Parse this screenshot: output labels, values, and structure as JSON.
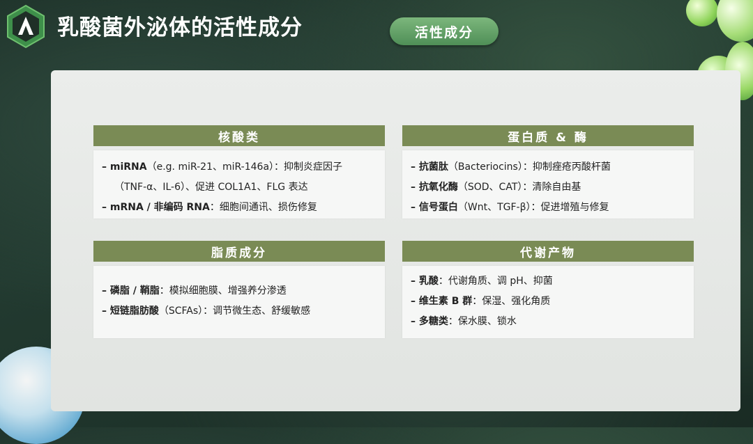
{
  "header": {
    "title": "乳酸菌外泌体的活性成分",
    "tag": "活性成分"
  },
  "cards": [
    {
      "heading": "核酸类",
      "items": [
        {
          "bold": "–  miRNA",
          "text": "（e.g. miR-21、miR-146a）：抑制炎症因子"
        },
        {
          "bold": "",
          "text": "（TNF-α、IL-6）、促进 COL1A1、FLG 表达"
        },
        {
          "bold": "– mRNA / 非编码 RNA",
          "text": "：细胞间通讯、损伤修复"
        }
      ]
    },
    {
      "heading": "蛋白质 & 酶",
      "items": [
        {
          "bold": "– 抗菌肽",
          "text": "（Bacteriocins）：抑制痤疮丙酸杆菌"
        },
        {
          "bold": "– 抗氧化酶",
          "text": "（SOD、CAT）：清除自由基"
        },
        {
          "bold": "– 信号蛋白",
          "text": "（Wnt、TGF-β）：促进增殖与修复"
        }
      ]
    },
    {
      "heading": "脂质成分",
      "items": [
        {
          "bold": "– 磷脂 / 鞘脂",
          "text": "：模拟细胞膜、增强养分渗透"
        },
        {
          "bold": "– 短链脂肪酸",
          "text": "（SCFAs）：调节微生态、舒缓敏感"
        }
      ]
    },
    {
      "heading": "代谢产物",
      "items": [
        {
          "bold": "– 乳酸",
          "text": "：代谢角质、调 pH、抑菌"
        },
        {
          "bold": "– 维生素 B 群",
          "text": "：保湿、强化角质"
        },
        {
          "bold": "– 多糖类",
          "text": "：保水膜、锁水"
        }
      ]
    }
  ]
}
